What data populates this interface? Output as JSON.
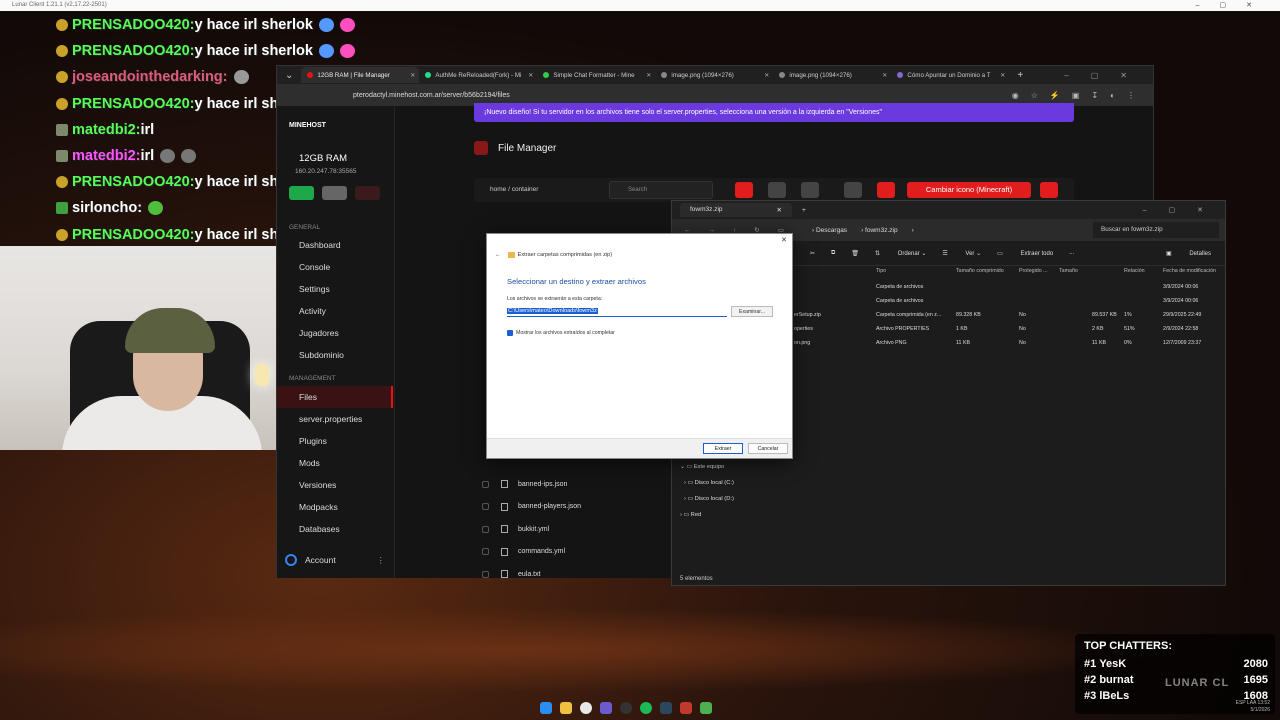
{
  "lunar": {
    "title": "Lunar Client 1.21.1 (v2.17.22-2501)"
  },
  "chat": [
    {
      "name": "PRENSADOO420:",
      "msg": " y hace irl sherlok",
      "color": "#55ff55",
      "badge": "c",
      "emotes": [
        "#5599ff",
        "#ff4fbf"
      ]
    },
    {
      "name": "PRENSADOO420:",
      "msg": " y hace irl sherlok",
      "color": "#55ff55",
      "badge": "c",
      "emotes": [
        "#5599ff",
        "#ff4fbf"
      ]
    },
    {
      "name": "joseandointhedarking:",
      "msg": "",
      "color": "#e05a7a",
      "badge": "c",
      "emotes": [
        "#999999"
      ]
    },
    {
      "name": "PRENSADOO420:",
      "msg": " y hace irl sherlok",
      "color": "#55ff55",
      "badge": "c",
      "emotes": [
        "#5599ff",
        "#ff4fbf"
      ]
    },
    {
      "name": "matedbi2:",
      "msg": " irl",
      "color": "#55ff55",
      "badge": "g",
      "emotes": []
    },
    {
      "name": "matedbi2:",
      "msg": " irl",
      "color": "#ff55ff",
      "badge": "g",
      "emotes": [
        "#777777",
        "#777777"
      ]
    },
    {
      "name": "PRENSADOO420:",
      "msg": " y hace irl sherlok",
      "color": "#55ff55",
      "badge": "c",
      "emotes": [
        "#5599ff",
        "#ff4fbf"
      ]
    },
    {
      "name": "sirloncho:",
      "msg": "",
      "color": "#ffffff",
      "badge": "l",
      "emotes": [
        "#4fbf3a"
      ]
    },
    {
      "name": "PRENSADOO420:",
      "msg": " y hace irl sherlok",
      "color": "#55ff55",
      "badge": "c",
      "emotes": [
        "#5599ff",
        "#ff4fbf"
      ]
    }
  ],
  "browser": {
    "tabs": [
      "12GB RAM | File Manager",
      "AuthMe ReReloaded(Fork) - Mi",
      "Simple Chat Formatter - Mine",
      "image.png (1094×276)",
      "image.png (1094×276)",
      "Cómo Apuntar un Dominio a T"
    ],
    "url": "pterodactyl.minehost.com.ar/server/b56b2194/files"
  },
  "panel": {
    "logo": "MINEHOST",
    "server_name": "12GB RAM",
    "ip": "160.20.247.78:35565",
    "section_general": "GENERAL",
    "section_management": "MANAGEMENT",
    "nav_general": [
      "Dashboard",
      "Console",
      "Settings",
      "Activity",
      "Jugadores",
      "Subdominio"
    ],
    "nav_management": [
      "Files",
      "server.properties",
      "Plugins",
      "Mods",
      "Versiones",
      "Modpacks",
      "Databases"
    ],
    "account": "Account",
    "banner": "¡Nuevo diseño! Si tu servidor en los archivos tiene solo el server.properties, selecciona una versión a la izquierda en \"Versiones\"",
    "title": "File Manager",
    "crumb_home": "home",
    "crumb_container": "container",
    "search_placeholder": "Search",
    "cambiar_icono": "Cambiar icono (Minecraft)",
    "files": [
      "banned-ips.json",
      "banned-players.json",
      "bukkit.yml",
      "commands.yml",
      "eula.txt"
    ]
  },
  "explorer": {
    "tab": "fowm3z.zip",
    "path": [
      "Descargas",
      "fowm3z.zip"
    ],
    "search": "Buscar en fowm3z.zip",
    "toolbar": {
      "ordenar": "Ordenar",
      "ver": "Ver",
      "extraer": "Extraer todo",
      "detalles": "Detalles",
      "more": "..."
    },
    "columns": [
      "Tipo",
      "Tamaño comprimido",
      "Protegido ...",
      "Tamaño",
      "Relación",
      "Fecha de modificación"
    ],
    "rows": [
      {
        "name": "",
        "type": "Carpeta de archivos",
        "csize": "",
        "prot": "",
        "size": "",
        "ratio": "",
        "date": "3/9/2024 00:06"
      },
      {
        "name": "",
        "type": "Carpeta de archivos",
        "csize": "",
        "prot": "",
        "size": "",
        "ratio": "",
        "date": "3/9/2024 00:06"
      },
      {
        "name": "erSetup.zip",
        "type": "Carpeta comprimida (en z...",
        "csize": "89.328 KB",
        "prot": "No",
        "size": "89.537 KB",
        "ratio": "1%",
        "date": "29/9/2025 22:49"
      },
      {
        "name": "operties",
        "type": "Archivo PROPERTIES",
        "csize": "1 KB",
        "prot": "No",
        "size": "2 KB",
        "ratio": "51%",
        "date": "2/9/2024 22:58"
      },
      {
        "name": "on.png",
        "type": "Archivo PNG",
        "csize": "11 KB",
        "prot": "No",
        "size": "11 KB",
        "ratio": "0%",
        "date": "12/7/2009 23:37"
      }
    ],
    "tree": [
      "Este equipo",
      "Disco local (C:)",
      "Disco local (D:)",
      "Red"
    ],
    "status": "5 elementos"
  },
  "dialog": {
    "header": "Extraer carpetas comprimidas (en zip)",
    "title": "Seleccionar un destino y extraer archivos",
    "label": "Los archivos se extraerán a esta carpeta:",
    "path": "C:\\Users\\mateo\\Downloads\\fowm3z",
    "examinar": "Examinar...",
    "checkbox": "Mostrar los archivos extraídos al completar",
    "extraer": "Extraer",
    "cancelar": "Cancelar"
  },
  "chatters": {
    "heading": "TOP CHATTERS:",
    "list": [
      {
        "rank": "#1",
        "name": "YesK",
        "count": "2080"
      },
      {
        "rank": "#2",
        "name": "burnat",
        "count": "1695"
      },
      {
        "rank": "#3",
        "name": "lBeLs",
        "count": "1608"
      }
    ]
  },
  "watermark": "LUNAR CL",
  "clock": {
    "time": "13:52",
    "date": "5/1/2026",
    "lang": "ESP LAA"
  }
}
